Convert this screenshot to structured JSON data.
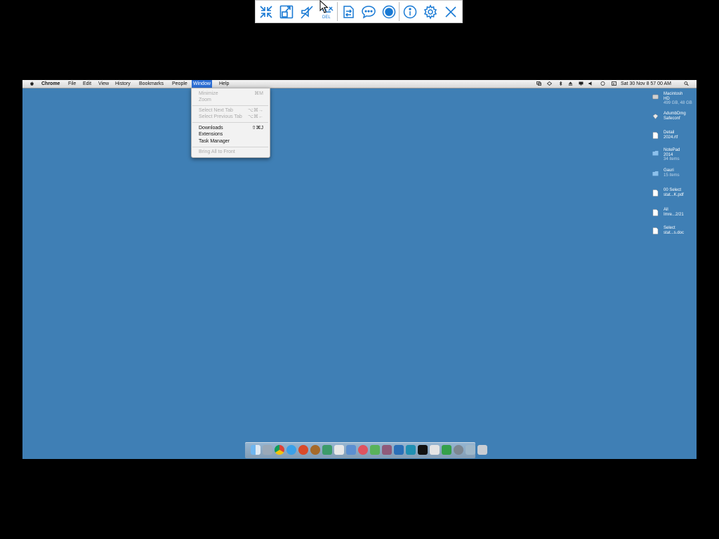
{
  "toolbar": {
    "icons": [
      "fit-screen-icon",
      "scale-icon",
      "mute-icon",
      "ctrl-alt-del-icon",
      "file-transfer-icon",
      "chat-icon",
      "record-icon",
      "info-icon",
      "settings-icon",
      "close-icon"
    ],
    "del_label": "DEL",
    "accent": "#1a7ad4"
  },
  "menubar": {
    "app": "Chrome",
    "items": [
      "File",
      "Edit",
      "View",
      "History",
      "Bookmarks",
      "People",
      "Window",
      "Help"
    ],
    "active": "Window",
    "clock": "Sat 30 Nov  8 57 00 AM"
  },
  "window_menu": {
    "items": [
      {
        "label": "Minimize",
        "shortcut": "⌘M",
        "enabled": false
      },
      {
        "label": "Zoom",
        "shortcut": "",
        "enabled": false
      },
      {
        "label": "Select Next Tab",
        "shortcut": "⌥⌘→",
        "enabled": false
      },
      {
        "label": "Select Previous Tab",
        "shortcut": "⌥⌘←",
        "enabled": false
      },
      {
        "label": "Downloads",
        "shortcut": "⇧⌘J",
        "enabled": true
      },
      {
        "label": "Extensions",
        "shortcut": "",
        "enabled": true
      },
      {
        "label": "Task Manager",
        "shortcut": "",
        "enabled": true
      },
      {
        "label": "Bring All to Front",
        "shortcut": "",
        "enabled": false
      }
    ]
  },
  "desktop": {
    "icons": [
      {
        "name": "Macintosh",
        "line2": "HD",
        "sub": "499 GB, 48 GB"
      },
      {
        "name": "AdumbDmg",
        "line2": "Safeconf",
        "sub": ""
      },
      {
        "name": "Detail",
        "line2": "2024.rtf",
        "sub": ""
      },
      {
        "name": "NotePad",
        "line2": "2014",
        "sub": "34 items"
      },
      {
        "name": "Gauri",
        "line2": "",
        "sub": "15 items"
      },
      {
        "name": "00 Select",
        "line2": "stat...K.pdf",
        "sub": ""
      },
      {
        "name": "All",
        "line2": "Imre...2/21",
        "sub": ""
      },
      {
        "name": "Select",
        "line2": "stat...s.doc",
        "sub": ""
      }
    ],
    "background_color": "#3f7fb5"
  },
  "dock": {
    "apps": [
      "finder",
      "preview",
      "chrome",
      "safari",
      "firefox",
      "scrubber",
      "network",
      "text-edit",
      "mail",
      "photos",
      "maps",
      "itunes",
      "photoshop",
      "xcode",
      "terminal",
      "messages",
      "skype",
      "system-prefs",
      "mac-app",
      "trash"
    ]
  }
}
